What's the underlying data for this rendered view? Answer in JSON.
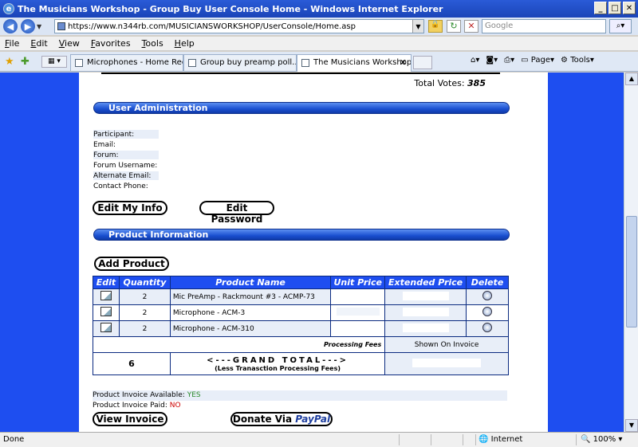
{
  "window": {
    "title": "The Musicians Workshop - Group Buy User Console Home - Windows Internet Explorer"
  },
  "address": {
    "url": "https://www.n344rb.com/MUSICIANSWORKSHOP/UserConsole/Home.asp",
    "search_placeholder": "Google"
  },
  "menu": [
    "File",
    "Edit",
    "View",
    "Favorites",
    "Tools",
    "Help"
  ],
  "tabs": [
    {
      "label": "Microphones - Home Recordi..."
    },
    {
      "label": "Group buy preamp poll... - P..."
    },
    {
      "label": "The Musicians Workshop ..."
    }
  ],
  "commandbar": {
    "page": "Page",
    "tools": "Tools"
  },
  "content": {
    "total_votes_label": "Total Votes:",
    "total_votes_value": "385",
    "user_admin": {
      "title": "User Administration",
      "fields": [
        "Participant:",
        "Email:",
        "Forum:",
        "Forum Username:",
        "Alternate Email:",
        "Contact Phone:"
      ],
      "edit_info": "Edit My Info",
      "edit_password": "Edit Password"
    },
    "product_info": {
      "title": "Product Information",
      "add_product": "Add Product",
      "columns": [
        "Edit",
        "Quantity",
        "Product Name",
        "Unit Price",
        "Extended Price",
        "Delete"
      ],
      "rows": [
        {
          "quantity": "2",
          "name": "Mic PreAmp - Rackmount #3 - ACMP-73"
        },
        {
          "quantity": "2",
          "name": "Microphone - ACM-3"
        },
        {
          "quantity": "2",
          "name": "Microphone - ACM-310"
        }
      ],
      "processing_fees_label": "Processing Fees",
      "processing_fees_value": "Shown On Invoice",
      "grand_qty": "6",
      "grand_total": "<---GRAND TOTAL--->",
      "grand_sub": "(Less Tranasction Processing Fees)"
    },
    "invoice": {
      "available_label": "Product Invoice Available:",
      "available_value": "YES",
      "paid_label": "Product Invoice Paid:",
      "paid_value": "NO",
      "view_invoice": "View Invoice",
      "donate_prefix": "Donate Via ",
      "donate_brand": "PayPal"
    }
  },
  "status": {
    "left": "Done",
    "zone": "Internet",
    "zoom": "100%"
  },
  "colors": {
    "page_blue": "#1e4ef0",
    "yes": "#2a8a2a",
    "no": "#cc0000",
    "paypal": "#1f3f9f"
  }
}
